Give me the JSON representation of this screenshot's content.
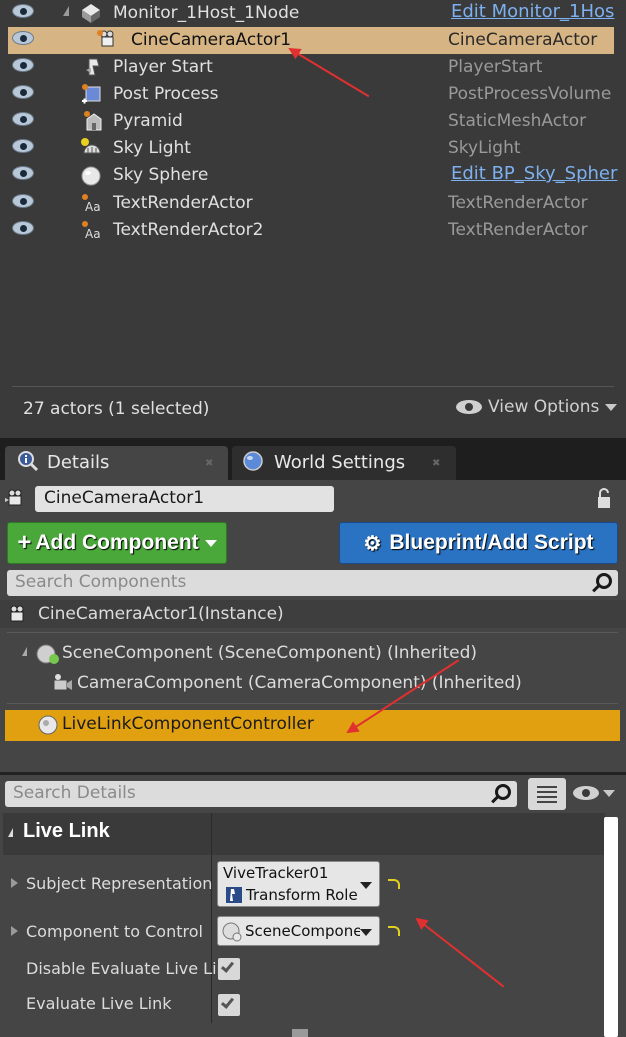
{
  "outliner": {
    "rows": [
      {
        "name": "Monitor_1Host_1Node",
        "type": "Edit Monitor_1Hos",
        "type_is_link": true,
        "icon": "monitor-icon"
      },
      {
        "name": "CineCameraActor1",
        "type": "CineCameraActor",
        "type_is_link": false,
        "icon": "cine-camera-icon"
      },
      {
        "name": "Player Start",
        "type": "PlayerStart",
        "type_is_link": false,
        "icon": "player-start-icon"
      },
      {
        "name": "Post Process",
        "type": "PostProcessVolume",
        "type_is_link": false,
        "icon": "post-process-icon"
      },
      {
        "name": "Pyramid",
        "type": "StaticMeshActor",
        "type_is_link": false,
        "icon": "static-mesh-icon"
      },
      {
        "name": "Sky Light",
        "type": "SkyLight",
        "type_is_link": false,
        "icon": "sky-light-icon"
      },
      {
        "name": "Sky Sphere",
        "type": "Edit BP_Sky_Spher",
        "type_is_link": true,
        "icon": "sky-sphere-icon"
      },
      {
        "name": "TextRenderActor",
        "type": "TextRenderActor",
        "type_is_link": false,
        "icon": "text-render-icon"
      },
      {
        "name": "TextRenderActor2",
        "type": "TextRenderActor",
        "type_is_link": false,
        "icon": "text-render-icon"
      }
    ],
    "actor_count": "27 actors (1 selected)",
    "view_options": "View Options"
  },
  "tabs": {
    "details": "Details",
    "world_settings": "World Settings"
  },
  "details": {
    "actor_name": "CineCameraActor1",
    "add_component": "Add Component",
    "blueprint": "Blueprint/Add Script",
    "search_components_placeholder": "Search Components",
    "instance": "CineCameraActor1(Instance)",
    "components": [
      "SceneComponent (SceneComponent) (Inherited)",
      "CameraComponent (CameraComponent) (Inherited)",
      "LiveLinkComponentController"
    ],
    "search_details_placeholder": "Search Details",
    "category": "Live Link",
    "props": {
      "subject_representation": "Subject Representation",
      "subject_name": "ViveTracker01",
      "subject_role": "Transform Role",
      "component_to_control": "Component to Control",
      "component_value": "SceneComponer",
      "disable_evaluate": "Disable Evaluate Live Link",
      "evaluate": "Evaluate Live Link"
    }
  },
  "colors": {
    "selected_row": "#d6b483",
    "highlight_component": "#e0a010",
    "add_button": "#4aa83a",
    "blueprint_button": "#2a72c2",
    "link": "#7db0ee",
    "annotation_arrow": "#e03030"
  }
}
